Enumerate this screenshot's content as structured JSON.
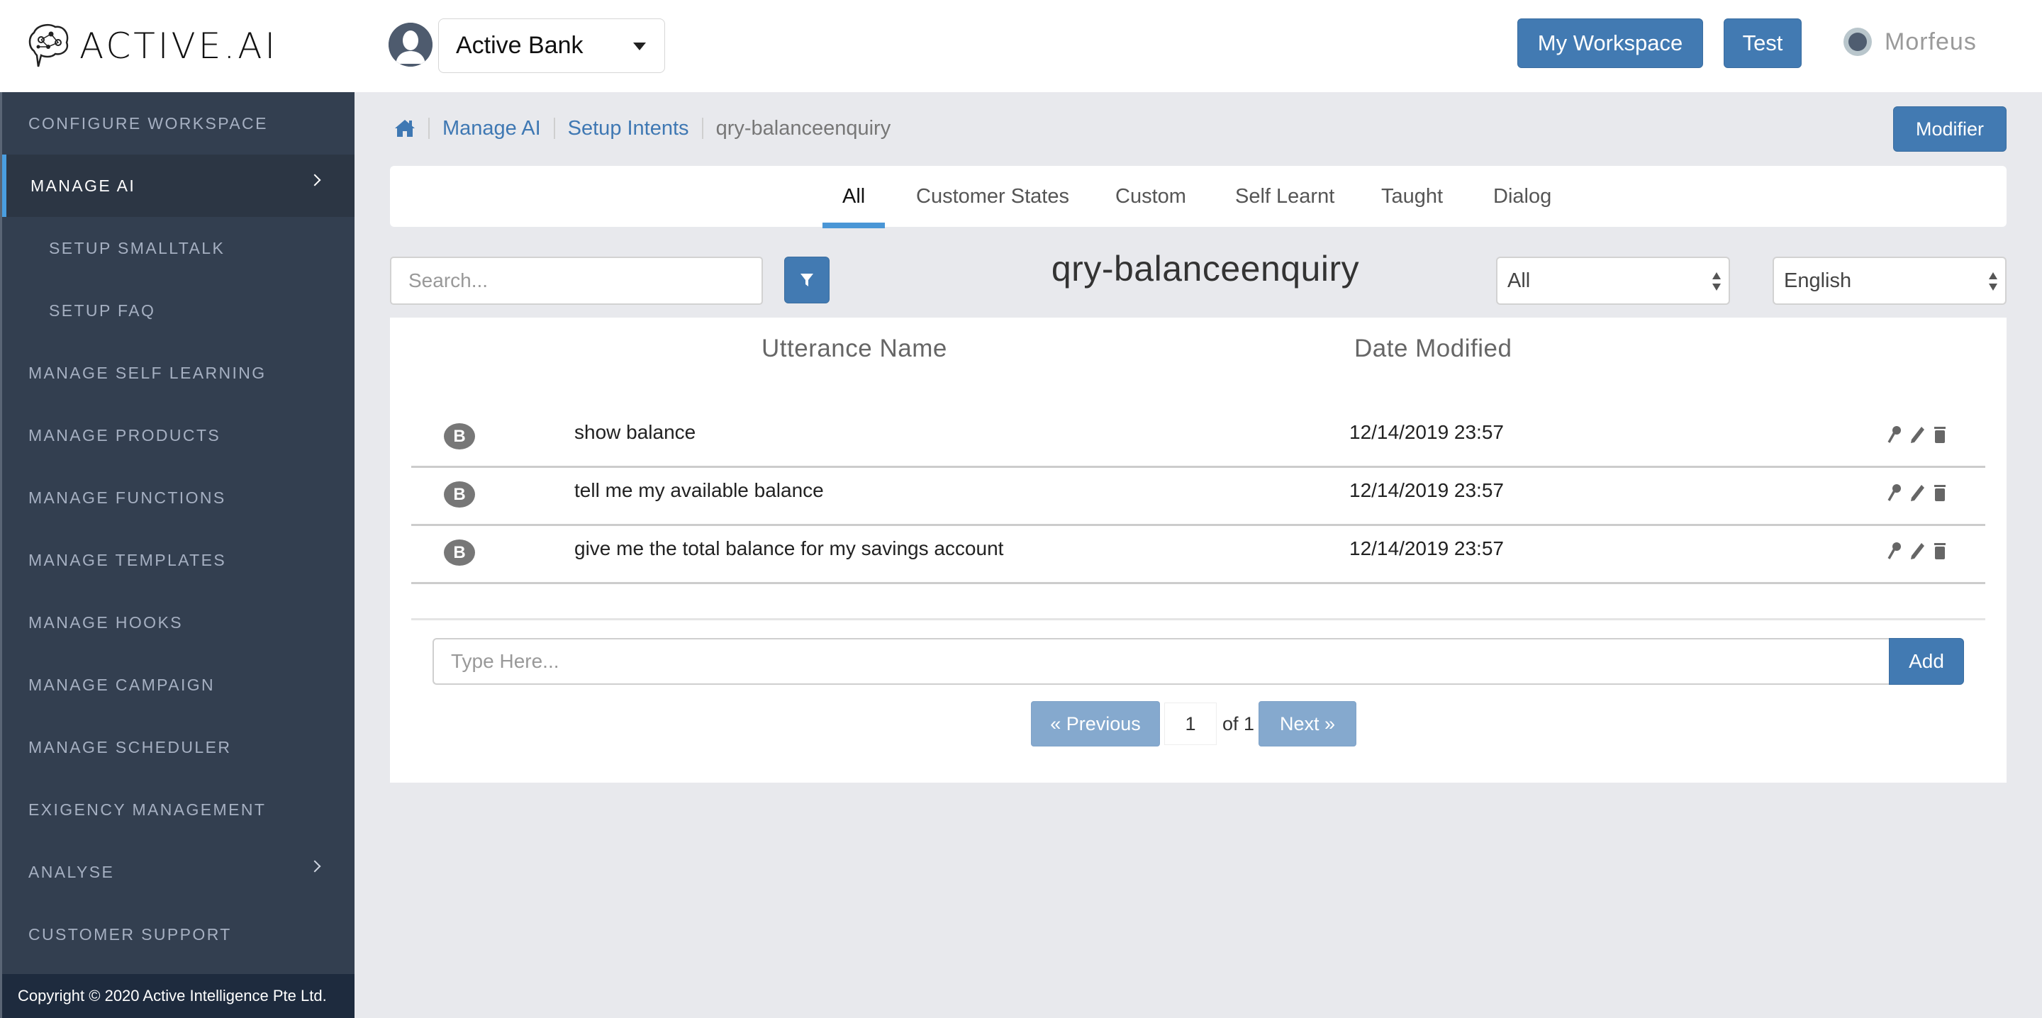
{
  "header": {
    "logo_text": "ACTIVE.AI",
    "bank_name": "Active Bank",
    "workspace_button": "My Workspace",
    "test_button": "Test",
    "user_name": "Morfeus"
  },
  "sidebar": {
    "items": [
      {
        "label": "CONFIGURE WORKSPACE"
      },
      {
        "label": "MANAGE AI"
      },
      {
        "label": "SETUP SMALLTALK"
      },
      {
        "label": "SETUP FAQ"
      },
      {
        "label": "MANAGE SELF LEARNING"
      },
      {
        "label": "MANAGE PRODUCTS"
      },
      {
        "label": "MANAGE FUNCTIONS"
      },
      {
        "label": "MANAGE TEMPLATES"
      },
      {
        "label": "MANAGE HOOKS"
      },
      {
        "label": "MANAGE CAMPAIGN"
      },
      {
        "label": "MANAGE SCHEDULER"
      },
      {
        "label": "EXIGENCY MANAGEMENT"
      },
      {
        "label": "ANALYSE"
      },
      {
        "label": "CUSTOMER SUPPORT"
      }
    ],
    "copyright": "Copyright © 2020 Active Intelligence Pte Ltd."
  },
  "breadcrumb": {
    "items": [
      "Manage AI",
      "Setup Intents"
    ],
    "current": "qry-balanceenquiry"
  },
  "modifier_button": "Modifier",
  "tabs": [
    "All",
    "Customer States",
    "Custom",
    "Self Learnt",
    "Taught",
    "Dialog"
  ],
  "active_tab": "All",
  "toolbar": {
    "search_placeholder": "Search...",
    "intent_title": "qry-balanceenquiry",
    "filter_select": "All",
    "language_select": "English"
  },
  "table": {
    "columns": [
      "Utterance Name",
      "Date Modified"
    ],
    "rows": [
      {
        "badge": "B",
        "utterance": "show balance",
        "date": "12/14/2019 23:57"
      },
      {
        "badge": "B",
        "utterance": "tell me my available balance",
        "date": "12/14/2019 23:57"
      },
      {
        "badge": "B",
        "utterance": "give me the total balance for my savings account",
        "date": "12/14/2019 23:57"
      }
    ]
  },
  "add_utterance": {
    "placeholder": "Type Here...",
    "button": "Add"
  },
  "pagination": {
    "previous": "« Previous",
    "page": "1",
    "of": "of 1",
    "next": "Next »"
  },
  "colors": {
    "primary": "#427ab2",
    "sidebar_bg": "#333f50",
    "active_indicator": "#4a9ee0",
    "page_bg": "#e8e9ed"
  }
}
